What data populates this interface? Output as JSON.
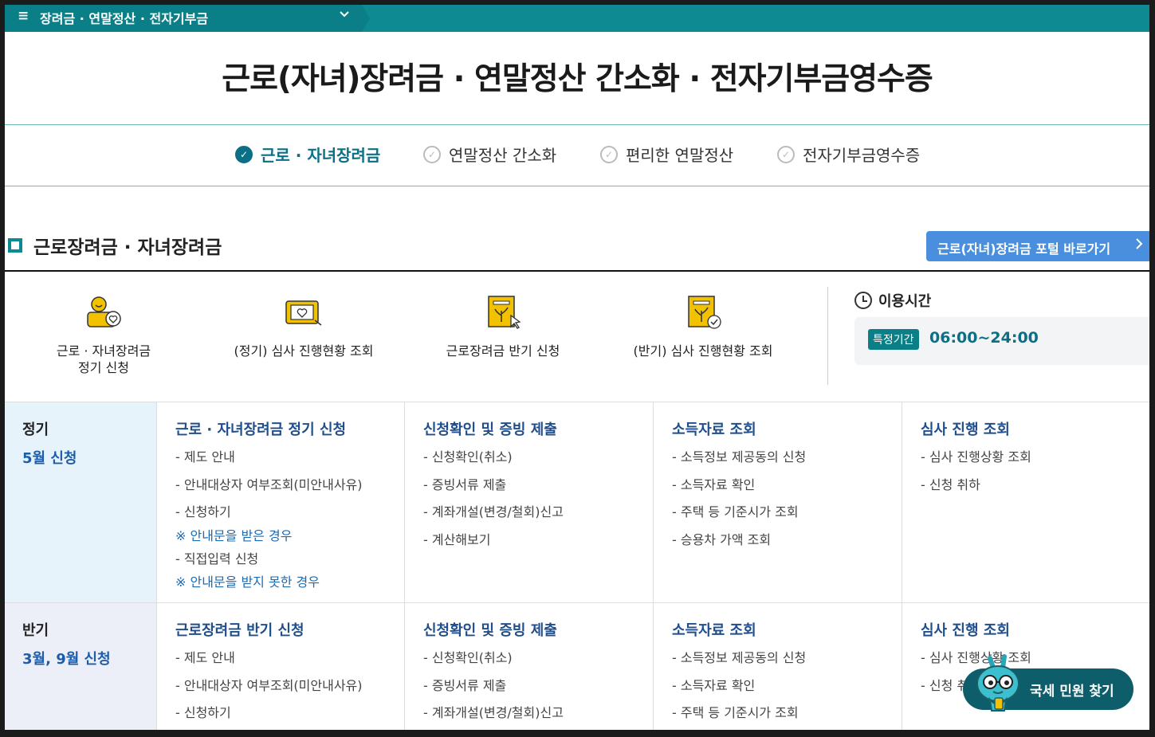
{
  "nav": {
    "breadcrumb": "장려금 · 연말정산 · 전자기부금",
    "menu_icon": "hamburger-icon",
    "dropdown_icon": "chevron-down-icon"
  },
  "page_title": "근로(자녀)장려금 · 연말정산 간소화 · 전자기부금영수증",
  "tabs": [
    {
      "label": "근로 · 자녀장려금",
      "active": true
    },
    {
      "label": "연말정산 간소화",
      "active": false
    },
    {
      "label": "편리한 연말정산",
      "active": false
    },
    {
      "label": "전자기부금영수증",
      "active": false
    }
  ],
  "section": {
    "title": "근로장려금 · 자녀장려금",
    "portal_button": "근로(자녀)장려금 포털 바로가기"
  },
  "quick_links": [
    {
      "label_line1": "근로 · 자녀장려금",
      "label_line2": "정기 신청",
      "icon": "person-heart-icon"
    },
    {
      "label_line1": "(정기) 심사 진행현황 조회",
      "label_line2": "",
      "icon": "monitor-heart-icon"
    },
    {
      "label_line1": "근로장려금 반기 신청",
      "label_line2": "",
      "icon": "document-click-icon"
    },
    {
      "label_line1": "(반기) 심사 진행현황 조회",
      "label_line2": "",
      "icon": "document-check-icon"
    }
  ],
  "hours": {
    "title": "이용시간",
    "badge": "특정기간",
    "time": "06:00~24:00"
  },
  "rows": [
    {
      "name": "정기",
      "period": "5월 신청",
      "cols": [
        {
          "heading": "근로 · 자녀장려금 정기 신청",
          "items": [
            "- 제도 안내",
            "- 안내대상자 여부조회(미안내사유)",
            "- 신청하기",
            "※ 안내문을 받은 경우",
            "- 직접입력 신청",
            "※ 안내문을 받지 못한 경우"
          ]
        },
        {
          "heading": "신청확인 및 증빙 제출",
          "items": [
            "- 신청확인(취소)",
            "- 증빙서류 제출",
            "- 계좌개설(변경/철회)신고",
            "- 계산해보기"
          ]
        },
        {
          "heading": "소득자료 조회",
          "items": [
            "- 소득정보 제공동의 신청",
            "- 소득자료 확인",
            "- 주택 등 기준시가 조회",
            "- 승용차 가액 조회"
          ]
        },
        {
          "heading": "심사 진행 조회",
          "items": [
            "- 심사 진행상황 조회",
            "- 신청 취하"
          ]
        }
      ]
    },
    {
      "name": "반기",
      "period": "3월, 9월 신청",
      "cols": [
        {
          "heading": "근로장려금 반기 신청",
          "items": [
            "- 제도 안내",
            "- 안내대상자 여부조회(미안내사유)",
            "- 신청하기"
          ]
        },
        {
          "heading": "신청확인 및 증빙 제출",
          "items": [
            "- 신청확인(취소)",
            "- 증빙서류 제출",
            "- 계좌개설(변경/철회)신고"
          ]
        },
        {
          "heading": "소득자료 조회",
          "items": [
            "- 소득정보 제공동의 신청",
            "- 소득자료 확인",
            "- 주택 등 기준시가 조회"
          ]
        },
        {
          "heading": "심사 진행 조회",
          "items": [
            "- 심사 진행상황 조회",
            "- 신청 취하"
          ]
        }
      ]
    }
  ],
  "fab": {
    "label": "국세 민원 찾기",
    "icon": "mascot-icon"
  },
  "colors": {
    "brand_teal": "#0e8a92",
    "active_tab": "#0b6f86",
    "link_blue": "#1f4e8c",
    "row1_bg": "#e6f3fb",
    "row2_bg": "#eceef8",
    "portal_button": "#4a8fdd"
  }
}
